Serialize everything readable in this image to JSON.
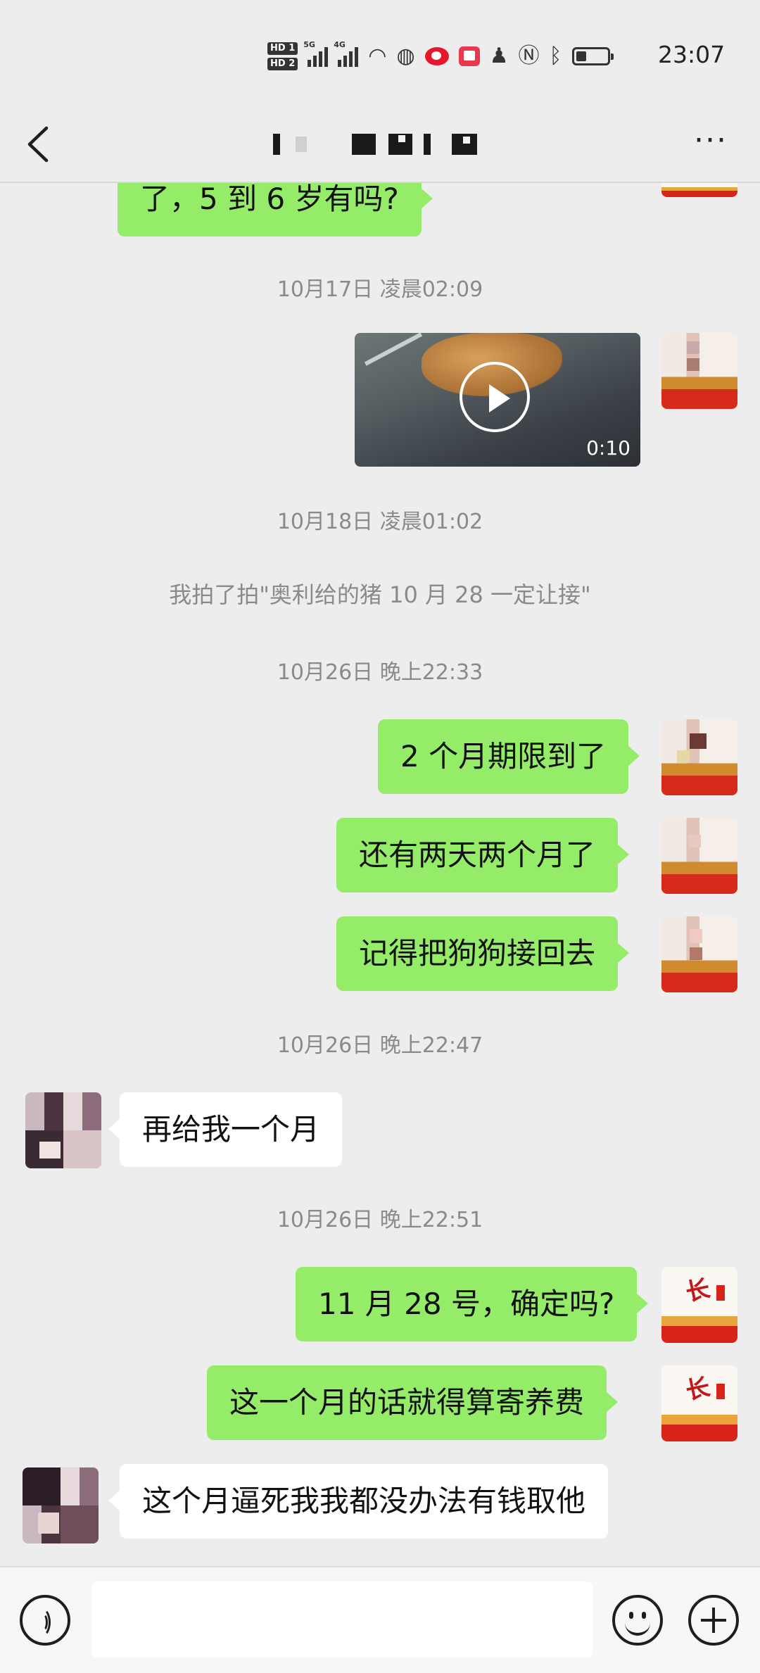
{
  "status_bar": {
    "hd_labels": [
      "HD 1",
      "HD 2"
    ],
    "network_labels": [
      "5G",
      "4G"
    ],
    "time": "23:07"
  },
  "header": {
    "back_icon": "chevron-left-icon",
    "contact_name": "",
    "more_icon": "ellipsis-icon"
  },
  "messages": {
    "m0": "了，5 到 6 岁有吗?",
    "ts1": "10月17日 凌晨02:09",
    "video_duration": "0:10",
    "ts2": "10月18日 凌晨01:02",
    "pat": "我拍了拍\"奥利给的猪 10 月 28 一定让接\"",
    "ts3": "10月26日 晚上22:33",
    "m1": "2 个月期限到了",
    "m2": "还有两天两个月了",
    "m3": "记得把狗狗接回去",
    "ts4": "10月26日 晚上22:47",
    "m4": "再给我一个月",
    "ts5": "10月26日 晚上22:51",
    "m5": "11 月 28 号，确定吗?",
    "m6": "这一个月的话就得算寄养费",
    "m7": "这个月逼死我我都没办法有钱取他"
  },
  "input_bar": {
    "voice_icon": "voice-icon",
    "message_value": "",
    "emoji_icon": "emoji-icon",
    "plus_icon": "plus-icon"
  },
  "colors": {
    "outgoing_bubble": "#95ec69",
    "incoming_bubble": "#ffffff",
    "background": "#ededed",
    "timestamp": "#8a8a8a"
  }
}
